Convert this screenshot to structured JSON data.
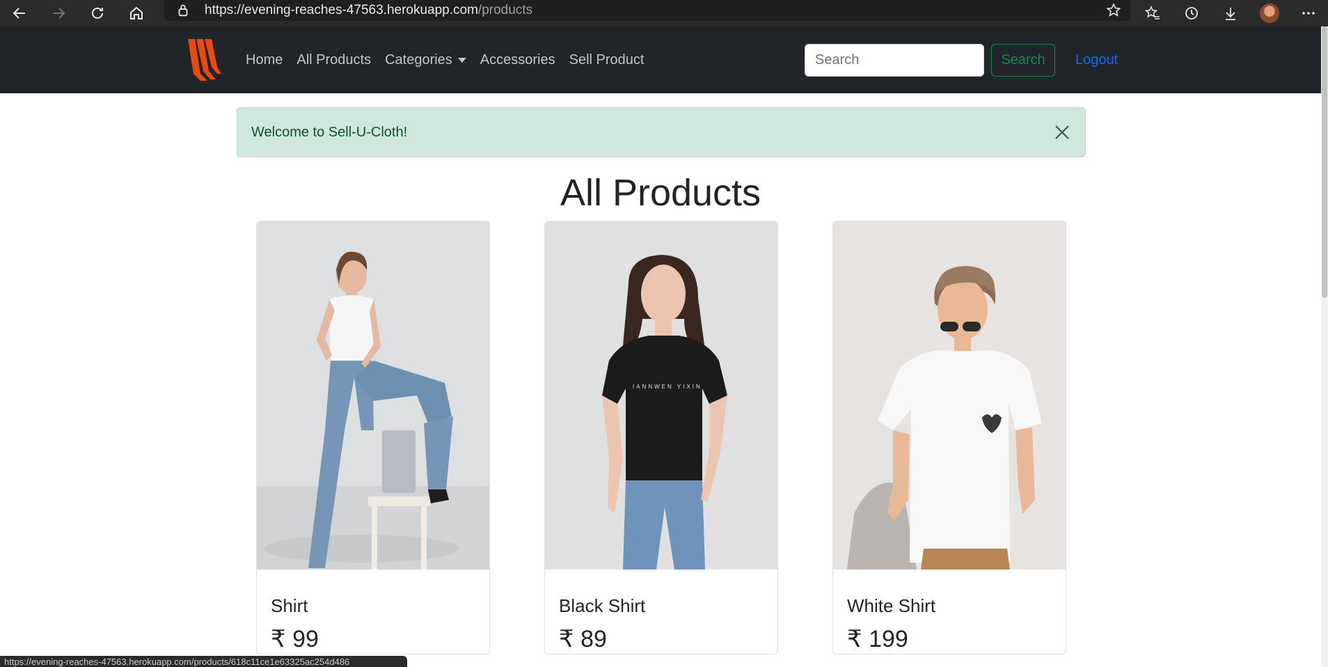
{
  "browser": {
    "url_host": "https://evening-reaches-47563.herokuapp.com",
    "url_path": "/products",
    "status_url": "https://evening-reaches-47563.herokuapp.com/products/618c11ce1e63325ac254d486"
  },
  "navbar": {
    "logo_icon": "brand-logo",
    "links": [
      "Home",
      "All Products",
      "Categories",
      "Accessories",
      "Sell Product"
    ],
    "search": {
      "placeholder": "Search",
      "button_label": "Search"
    },
    "logout_label": "Logout",
    "colors": {
      "bg": "#212529",
      "logo": "#e84a12",
      "logout": "#0d6efd",
      "search_btn": "#198754"
    }
  },
  "alert": {
    "message": "Welcome to Sell-U-Cloth!",
    "bg": "#d1e7dd"
  },
  "main": {
    "title": "All Products",
    "products": [
      {
        "name": "Shirt",
        "price": "₹ 99"
      },
      {
        "name": "Black Shirt",
        "price": "₹ 89"
      },
      {
        "name": "White Shirt",
        "price": "₹ 199"
      }
    ]
  }
}
